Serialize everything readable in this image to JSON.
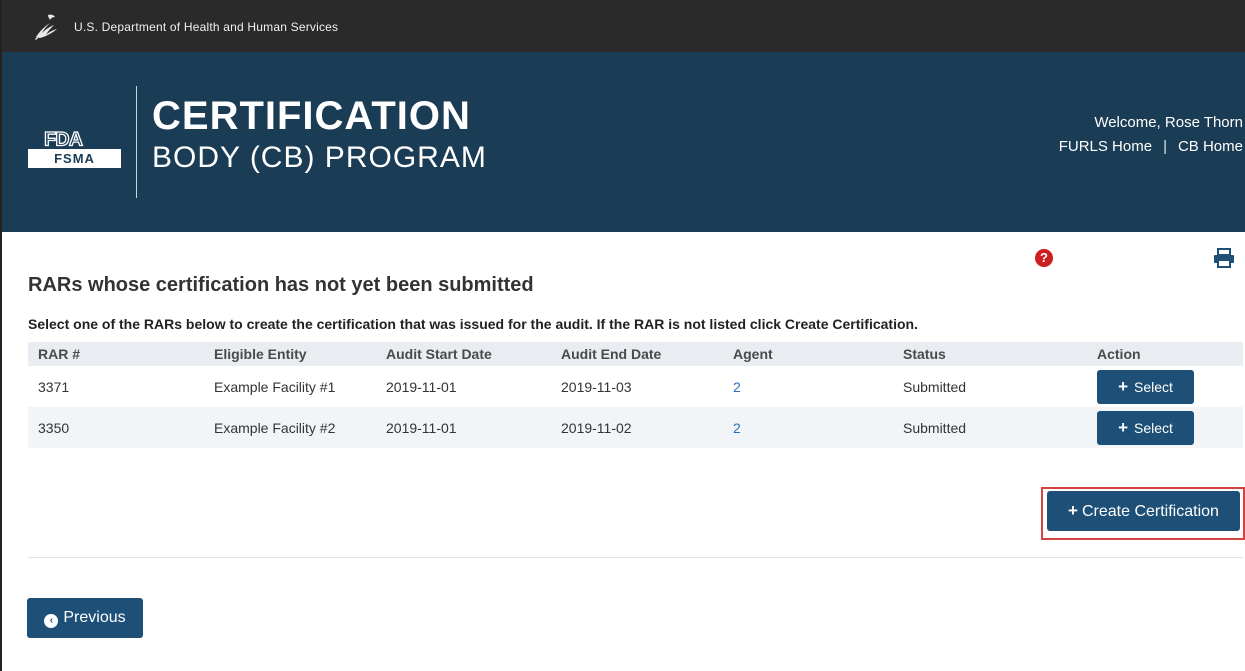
{
  "hhs_bar": {
    "text": "U.S. Department of Health and Human Services",
    "icon": "hhs-eagle-icon"
  },
  "header": {
    "fda_logo": "FDA",
    "fsma_badge": "FSMA",
    "title_line1": "CERTIFICATION",
    "title_line2": "BODY (CB) PROGRAM",
    "welcome": "Welcome, Rose Thorn",
    "links": [
      "FURLS Home",
      "CB Home"
    ],
    "separator": "|"
  },
  "icons": {
    "help": "?",
    "help_icon": "help-icon",
    "print_icon": "print-icon"
  },
  "page": {
    "heading": "RARs whose certification has not yet been submitted",
    "instructions": "Select one of the RARs below to create the certification that was issued for the audit. If the RAR is not listed click Create Certification."
  },
  "table": {
    "headers": [
      "RAR #",
      "Eligible Entity",
      "Audit Start Date",
      "Audit End Date",
      "Agent",
      "Status",
      "Action"
    ],
    "rows": [
      {
        "rar": "3371",
        "entity": "Example Facility #1",
        "start": "2019-11-01",
        "end": "2019-11-03",
        "agent": "2",
        "status": "Submitted",
        "action": "Select"
      },
      {
        "rar": "3350",
        "entity": "Example Facility #2",
        "start": "2019-11-01",
        "end": "2019-11-02",
        "agent": "2",
        "status": "Submitted",
        "action": "Select"
      }
    ]
  },
  "buttons": {
    "plus": "+",
    "create": "Create Certification",
    "previous": "Previous",
    "prev_glyph": "‹"
  },
  "colors": {
    "header_blue": "#1b3c55",
    "button_blue": "#1d4f77",
    "hhs_bar": "#2a2a2a",
    "highlight": "#d4433f",
    "help_red": "#cc1f1f"
  }
}
